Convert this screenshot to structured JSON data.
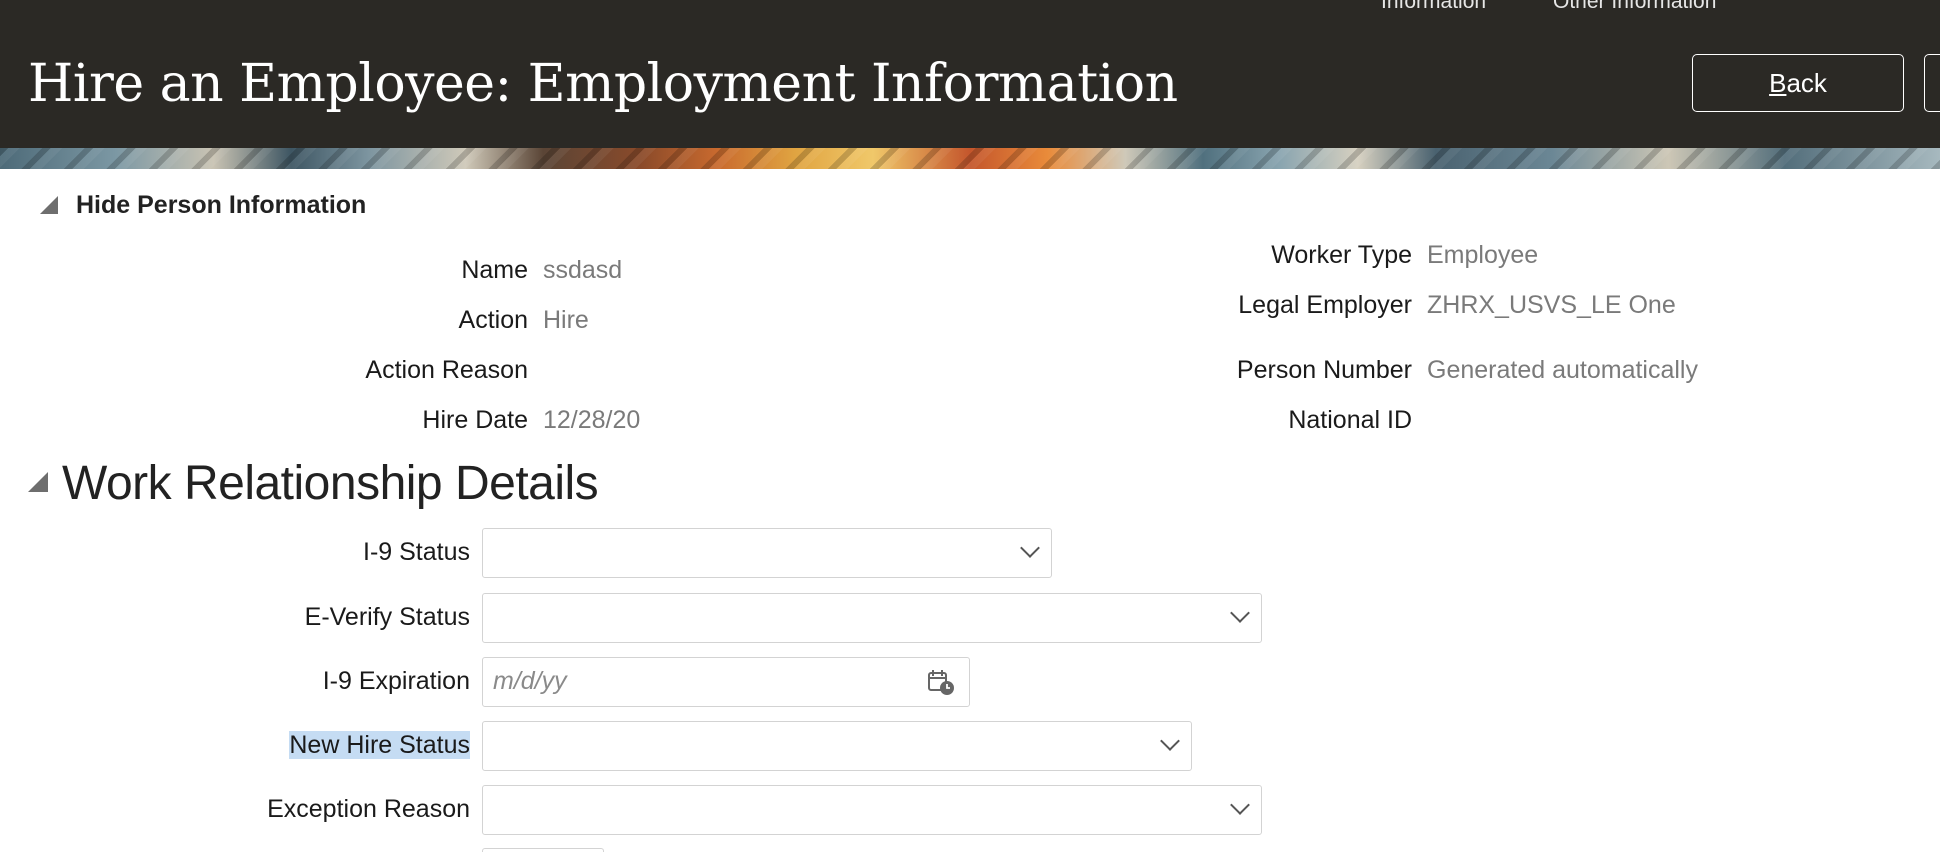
{
  "header": {
    "title": "Hire an Employee: Employment Information",
    "train_steps": [
      "Information",
      "Other Information"
    ],
    "back_label": "Back",
    "back_mnemonic": "B",
    "back_rest": "ack"
  },
  "person_info": {
    "toggle_label": "Hide Person Information",
    "left": [
      {
        "label": "Name",
        "value": "ssdasd"
      },
      {
        "label": "Action",
        "value": "Hire"
      },
      {
        "label": "Action Reason",
        "value": ""
      },
      {
        "label": "Hire Date",
        "value": "12/28/20"
      }
    ],
    "right": [
      {
        "label": "Worker Type",
        "value": "Employee"
      },
      {
        "label": "Legal Employer",
        "value": "ZHRX_USVS_LE One"
      },
      {
        "label": "Person Number",
        "value": "Generated automatically"
      },
      {
        "label": "National ID",
        "value": ""
      }
    ]
  },
  "work_relationship": {
    "title": "Work Relationship Details",
    "fields": [
      {
        "label": "I-9 Status",
        "type": "select",
        "value": ""
      },
      {
        "label": "E-Verify Status",
        "type": "select",
        "value": ""
      },
      {
        "label": "I-9 Expiration",
        "type": "date",
        "value": "",
        "placeholder": "m/d/yy"
      },
      {
        "label": "New Hire Status",
        "type": "select",
        "value": ""
      },
      {
        "label": "Exception Reason",
        "type": "select",
        "value": ""
      }
    ]
  },
  "icons": {
    "section_toggle": "collapse-triangle-icon",
    "select_arrow": "chevron-down-icon",
    "date_picker": "calendar-icon"
  },
  "colors": {
    "header_bg": "#2b2925",
    "label_highlight": "#c5dcf3",
    "value_text": "#7a7a7a"
  }
}
